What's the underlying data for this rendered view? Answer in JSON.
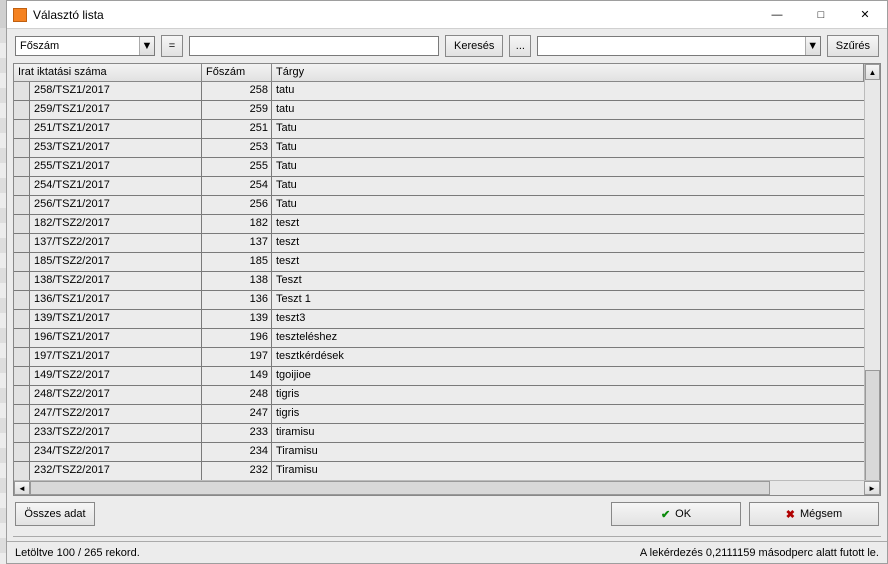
{
  "window": {
    "title": "Választó lista"
  },
  "toolbar": {
    "field_combo": "Főszám",
    "eq_label": "=",
    "search_value": "",
    "search_btn": "Keresés",
    "dots_btn": "...",
    "filter_combo": "",
    "filter_btn": "Szűrés"
  },
  "columns": {
    "c1": "Irat iktatási száma",
    "c2": "Főszám",
    "c3": "Tárgy"
  },
  "rows": [
    {
      "c1": "258/TSZ1/2017",
      "c2": "258",
      "c3": "tatu"
    },
    {
      "c1": "259/TSZ1/2017",
      "c2": "259",
      "c3": "tatu"
    },
    {
      "c1": "251/TSZ1/2017",
      "c2": "251",
      "c3": "Tatu"
    },
    {
      "c1": "253/TSZ1/2017",
      "c2": "253",
      "c3": "Tatu"
    },
    {
      "c1": "255/TSZ1/2017",
      "c2": "255",
      "c3": "Tatu"
    },
    {
      "c1": "254/TSZ1/2017",
      "c2": "254",
      "c3": "Tatu"
    },
    {
      "c1": "256/TSZ1/2017",
      "c2": "256",
      "c3": "Tatu"
    },
    {
      "c1": "182/TSZ2/2017",
      "c2": "182",
      "c3": "teszt"
    },
    {
      "c1": "137/TSZ2/2017",
      "c2": "137",
      "c3": "teszt"
    },
    {
      "c1": "185/TSZ2/2017",
      "c2": "185",
      "c3": "teszt"
    },
    {
      "c1": "138/TSZ2/2017",
      "c2": "138",
      "c3": "Teszt"
    },
    {
      "c1": "136/TSZ1/2017",
      "c2": "136",
      "c3": "Teszt 1"
    },
    {
      "c1": "139/TSZ1/2017",
      "c2": "139",
      "c3": "teszt3"
    },
    {
      "c1": "196/TSZ1/2017",
      "c2": "196",
      "c3": "teszteléshez"
    },
    {
      "c1": "197/TSZ1/2017",
      "c2": "197",
      "c3": "tesztkérdések"
    },
    {
      "c1": "149/TSZ2/2017",
      "c2": "149",
      "c3": "tgoijioe"
    },
    {
      "c1": "248/TSZ2/2017",
      "c2": "248",
      "c3": "tigris"
    },
    {
      "c1": "247/TSZ2/2017",
      "c2": "247",
      "c3": "tigris"
    },
    {
      "c1": "233/TSZ2/2017",
      "c2": "233",
      "c3": "tiramisu"
    },
    {
      "c1": "234/TSZ2/2017",
      "c2": "234",
      "c3": "Tiramisu"
    },
    {
      "c1": "232/TSZ2/2017",
      "c2": "232",
      "c3": "Tiramisu"
    }
  ],
  "buttons": {
    "all_data": "Összes adat",
    "ok": "OK",
    "cancel": "Mégsem"
  },
  "status": {
    "left": "Letöltve 100 / 265 rekord.",
    "right": "A lekérdezés 0,2111159 másodperc alatt futott le."
  }
}
